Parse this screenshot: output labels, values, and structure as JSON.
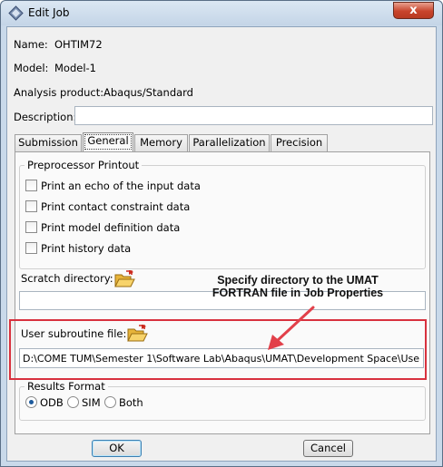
{
  "window": {
    "title": "Edit Job",
    "close_glyph": "x"
  },
  "fields": {
    "name_label": "Name:",
    "name_value": "OHTIM72",
    "model_label": "Model:",
    "model_value": "Model-1",
    "product_label": "Analysis product:",
    "product_value": "Abaqus/Standard",
    "description_label": "Description:",
    "description_value": ""
  },
  "tabs": [
    {
      "label": "Submission"
    },
    {
      "label": "General",
      "active": true
    },
    {
      "label": "Memory"
    },
    {
      "label": "Parallelization"
    },
    {
      "label": "Precision"
    }
  ],
  "preprocessor": {
    "title": "Preprocessor Printout",
    "options": [
      {
        "label": "Print an echo of the input data",
        "checked": false
      },
      {
        "label": "Print contact constraint data",
        "checked": false
      },
      {
        "label": "Print model definition data",
        "checked": false
      },
      {
        "label": "Print history data",
        "checked": false
      }
    ]
  },
  "scratch": {
    "label": "Scratch directory:",
    "value": "",
    "icon": "folder-open-icon"
  },
  "subroutine": {
    "label": "User subroutine file:",
    "value": "D:\\COME TUM\\Semester 1\\Software Lab\\Abaqus\\UMAT\\Development Space\\User M",
    "icon": "folder-open-icon"
  },
  "results": {
    "title": "Results Format",
    "options": [
      {
        "label": "ODB",
        "selected": true
      },
      {
        "label": "SIM",
        "selected": false
      },
      {
        "label": "Both",
        "selected": false
      }
    ]
  },
  "buttons": {
    "ok": "OK",
    "cancel": "Cancel"
  },
  "annotation": {
    "line1": "Specify directory to the UMAT",
    "line2": "FORTRAN file in Job Properties",
    "color": "#d8313e"
  }
}
